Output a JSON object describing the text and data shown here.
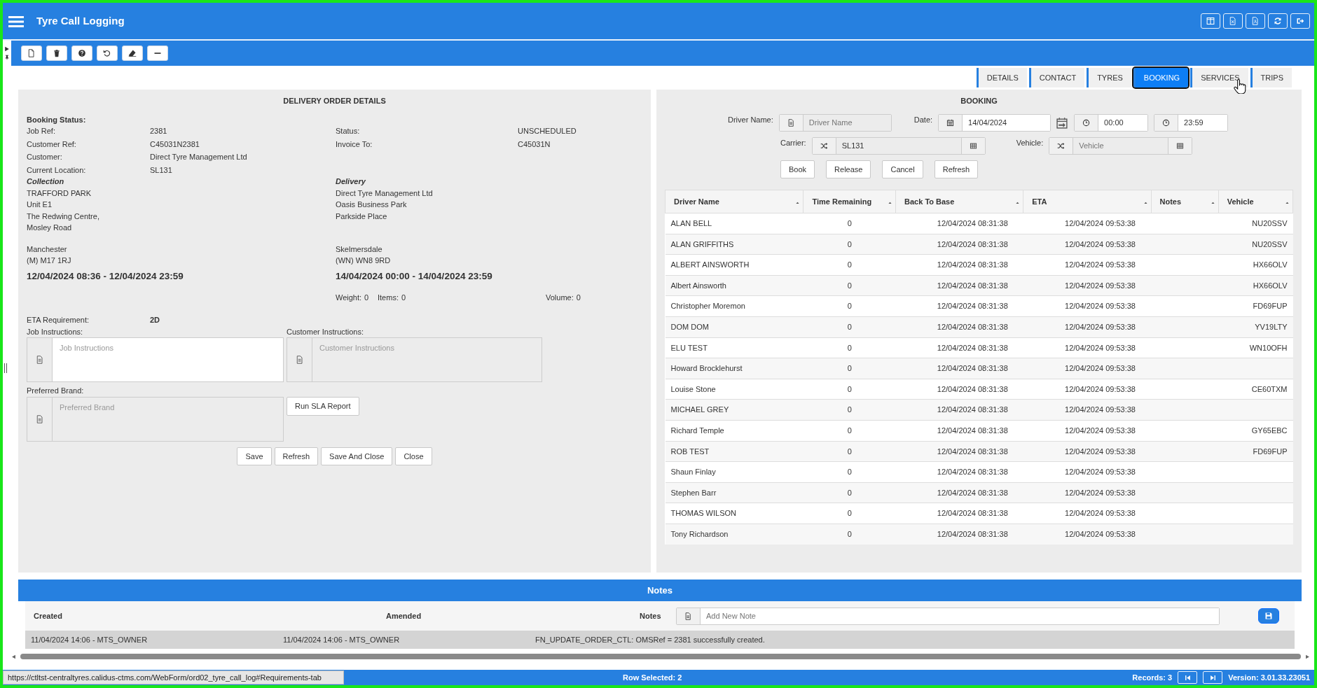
{
  "window": {
    "title": "Tyre Call Logging"
  },
  "tabs": [
    {
      "label": "DETAILS",
      "selected": false
    },
    {
      "label": "CONTACT",
      "selected": false
    },
    {
      "label": "TYRES",
      "selected": false
    },
    {
      "label": "BOOKING",
      "selected": true
    },
    {
      "label": "SERVICES",
      "selected": false
    },
    {
      "label": "TRIPS",
      "selected": false
    }
  ],
  "delivery_order": {
    "title": "DELIVERY ORDER DETAILS",
    "booking_status_label": "Booking Status:",
    "fields": [
      {
        "label": "Job Ref:",
        "value": "2381",
        "label_2": "Status:",
        "value_2": "UNSCHEDULED"
      },
      {
        "label": "Customer Ref:",
        "value": "C45031N2381",
        "label_2": "Invoice To:",
        "value_2": "C45031N"
      },
      {
        "label": "Customer:",
        "value": "Direct Tyre Management Ltd"
      },
      {
        "label": "Current Location:",
        "value": "SL131"
      }
    ],
    "collection": {
      "heading": "Collection",
      "lines": [
        [
          "TRAFFORD PARK",
          "Unit E1",
          "The Redwing Centre,",
          "Mosley Road"
        ],
        [
          "Manchester",
          "(M) M17 1RJ"
        ]
      ],
      "window": "12/04/2024 08:36 - 12/04/2024 23:59"
    },
    "delivery": {
      "heading": "Delivery",
      "lines": [
        [
          "Direct Tyre Management Ltd",
          "Oasis Business Park",
          "Parkside Place"
        ],
        [
          "Skelmersdale",
          "(WN) WN8 9RD"
        ]
      ],
      "window": "14/04/2024 00:00 - 14/04/2024 23:59"
    },
    "measures": [
      {
        "label": "Weight:",
        "value": "0"
      },
      {
        "label": "Items:",
        "value": "0"
      },
      {
        "label": "Volume:",
        "value": "0"
      }
    ],
    "eta": {
      "label": "ETA Requirement:",
      "value": "2D"
    },
    "job_instructions": {
      "label": "Job Instructions:",
      "placeholder": "Job Instructions"
    },
    "customer_instructions": {
      "label": "Customer Instructions:",
      "placeholder": "Customer Instructions"
    },
    "preferred_brand": {
      "label": "Preferred Brand:",
      "placeholder": "Preferred Brand"
    },
    "sla_button": "Run SLA Report",
    "buttons": [
      "Save",
      "Refresh",
      "Save And Close",
      "Close"
    ]
  },
  "booking": {
    "title": "BOOKING",
    "driver_name": {
      "label": "Driver Name:",
      "placeholder": "Driver Name"
    },
    "date": {
      "label": "Date:",
      "value": "14/04/2024"
    },
    "time_from": "00:00",
    "time_to": "23:59",
    "carrier": {
      "label": "Carrier:",
      "value": "SL131"
    },
    "vehicle": {
      "label": "Vehicle:",
      "placeholder": "Vehicle"
    },
    "buttons": [
      "Book",
      "Release",
      "Cancel",
      "Refresh"
    ],
    "columns": [
      "Driver Name",
      "Time Remaining",
      "Back To Base",
      "ETA",
      "Notes",
      "Vehicle"
    ],
    "rows": [
      [
        "ALAN BELL",
        "0",
        "12/04/2024 08:31:38",
        "12/04/2024 09:53:38",
        "",
        "NU20SSV"
      ],
      [
        "ALAN GRIFFITHS",
        "0",
        "12/04/2024 08:31:38",
        "12/04/2024 09:53:38",
        "",
        "NU20SSV"
      ],
      [
        "ALBERT AINSWORTH",
        "0",
        "12/04/2024 08:31:38",
        "12/04/2024 09:53:38",
        "",
        "HX66OLV"
      ],
      [
        "Albert Ainsworth",
        "0",
        "12/04/2024 08:31:38",
        "12/04/2024 09:53:38",
        "",
        "HX66OLV"
      ],
      [
        "Christopher Moremon",
        "0",
        "12/04/2024 08:31:38",
        "12/04/2024 09:53:38",
        "",
        "FD69FUP"
      ],
      [
        "DOM DOM",
        "0",
        "12/04/2024 08:31:38",
        "12/04/2024 09:53:38",
        "",
        "YV19LTY"
      ],
      [
        "ELU TEST",
        "0",
        "12/04/2024 08:31:38",
        "12/04/2024 09:53:38",
        "",
        "WN10OFH"
      ],
      [
        "Howard Brocklehurst",
        "0",
        "12/04/2024 08:31:38",
        "12/04/2024 09:53:38",
        "",
        ""
      ],
      [
        "Louise Stone",
        "0",
        "12/04/2024 08:31:38",
        "12/04/2024 09:53:38",
        "",
        "CE60TXM"
      ],
      [
        "MICHAEL GREY",
        "0",
        "12/04/2024 08:31:38",
        "12/04/2024 09:53:38",
        "",
        ""
      ],
      [
        "Richard Temple",
        "0",
        "12/04/2024 08:31:38",
        "12/04/2024 09:53:38",
        "",
        "GY65EBC"
      ],
      [
        "ROB TEST",
        "0",
        "12/04/2024 08:31:38",
        "12/04/2024 09:53:38",
        "",
        "FD69FUP"
      ],
      [
        "Shaun Finlay",
        "0",
        "12/04/2024 08:31:38",
        "12/04/2024 09:53:38",
        "",
        ""
      ],
      [
        "Stephen Barr",
        "0",
        "12/04/2024 08:31:38",
        "12/04/2024 09:53:38",
        "",
        ""
      ],
      [
        "THOMAS WILSON",
        "0",
        "12/04/2024 08:31:38",
        "12/04/2024 09:53:38",
        "",
        ""
      ],
      [
        "Tony Richardson",
        "0",
        "12/04/2024 08:31:38",
        "12/04/2024 09:53:38",
        "",
        ""
      ]
    ]
  },
  "notes": {
    "title": "Notes",
    "columns": [
      "Created",
      "Amended",
      "Notes"
    ],
    "placeholder": "Add New Note",
    "rows": [
      [
        "11/04/2024 14:06 - MTS_OWNER",
        "11/04/2024 14:06 - MTS_OWNER",
        "FN_UPDATE_ORDER_CTL: OMSRef = 2381 successfully created."
      ]
    ]
  },
  "status_bar": {
    "link_preview": "https://ctltst-centraltyres.calidus-ctms.com/WebForm/ord02_tyre_call_log#Requirements-tab",
    "row_selected": "Row Selected: 2",
    "records": "Records: 3",
    "version": "Version: 3.01.33.23051"
  }
}
